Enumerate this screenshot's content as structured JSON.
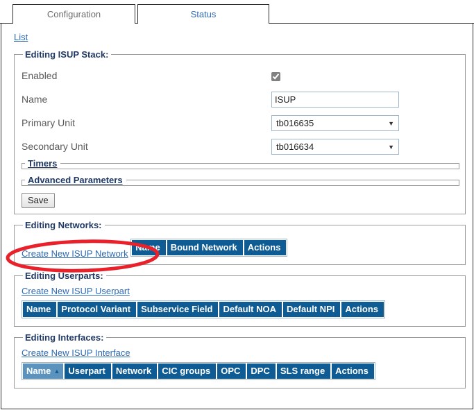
{
  "tabs": [
    {
      "label": "Configuration",
      "active": true
    },
    {
      "label": "Status",
      "active": false
    }
  ],
  "breadcrumb": {
    "list_label": "List"
  },
  "stack_section": {
    "legend": "Editing ISUP Stack:",
    "fields": {
      "enabled": {
        "label": "Enabled",
        "checked": true
      },
      "name": {
        "label": "Name",
        "value": "ISUP",
        "placeholder": ""
      },
      "primary_unit": {
        "label": "Primary Unit",
        "value": "tb016635",
        "caret": "▼"
      },
      "secondary_unit": {
        "label": "Secondary Unit",
        "value": "tb016634",
        "caret": "▼"
      }
    },
    "timers_legend": "Timers",
    "advanced_legend": "Advanced Parameters",
    "save_label": "Save"
  },
  "networks_section": {
    "legend": "Editing Networks:",
    "create_link": "Create New ISUP Network",
    "columns": [
      "Name",
      "Bound Network",
      "Actions"
    ],
    "rows": []
  },
  "userparts_section": {
    "legend": "Editing Userparts:",
    "create_link": "Create New ISUP Userpart",
    "columns": [
      "Name",
      "Protocol Variant",
      "Subservice Field",
      "Default NOA",
      "Default NPI",
      "Actions"
    ],
    "rows": []
  },
  "interfaces_section": {
    "legend": "Editing Interfaces:",
    "create_link": "Create New ISUP Interface",
    "columns": [
      "Name",
      "Userpart",
      "Network",
      "CIC groups",
      "OPC",
      "DPC",
      "SLS range",
      "Actions"
    ],
    "sorted_column": "Name",
    "sort_caret": "▲",
    "rows": []
  },
  "annotation": {
    "shape": "ellipse",
    "color": "#e8212a",
    "target": "Create New ISUP Network"
  },
  "colors": {
    "header_blue": "#0f5c94",
    "sorted_header_blue": "#5b93bd",
    "link_blue": "#2f6bb3",
    "legend_navy": "#1f3864",
    "annotation_red": "#e8212a"
  }
}
